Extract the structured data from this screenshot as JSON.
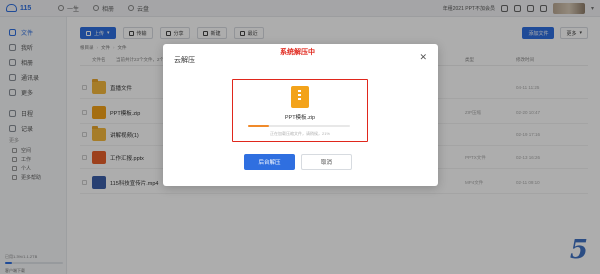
{
  "app": {
    "logo": "115"
  },
  "topnav": [
    "一生",
    "相册",
    "云盘"
  ],
  "topbar": {
    "notice": "年租2021 PPT不加会员"
  },
  "sidebar": {
    "items": [
      {
        "label": "文件",
        "active": true
      },
      {
        "label": "我听"
      },
      {
        "label": "相册"
      },
      {
        "label": "通讯录"
      },
      {
        "label": "更多"
      },
      {
        "label": "日程"
      },
      {
        "label": "记录"
      }
    ],
    "group_label": "更多",
    "subitems": [
      "空间",
      "工作",
      "个人",
      "更多帮助"
    ],
    "storage_text": "已用1.3%/1.1.2TB",
    "storage_fraction": 0.12,
    "storage_link": "客户端下载"
  },
  "toolbar": {
    "upload": "上传",
    "transfer": "传输",
    "share": "分享",
    "new_folder": "新建",
    "recent": "最近",
    "right_primary": "添加文件",
    "more": "更多"
  },
  "breadcrumb": [
    "根目录",
    "文件",
    "文件"
  ],
  "columns": {
    "name": "文件名",
    "info": "当前共计23个文件，2个文件夹",
    "type": "类型",
    "date": "修改时间"
  },
  "files": [
    {
      "name": "直播文件",
      "kind": "folder",
      "type": "",
      "date": "04-11 11:25"
    },
    {
      "name": "PPT模板.zip",
      "kind": "zip",
      "type": "ZIP压缩",
      "date": "02-20 10:47"
    },
    {
      "name": "讲解视频(1)",
      "kind": "folder",
      "type": "",
      "date": "02-19 17:16"
    },
    {
      "name": "工作汇报.pptx",
      "kind": "ppt",
      "type": "PPTX文件",
      "date": "02-13 16:26"
    },
    {
      "name": "115科技宣传片.mp4",
      "kind": "mp4",
      "type": "MP4文件",
      "date": "02-11 09:10"
    }
  ],
  "dialog": {
    "title": "云解压",
    "note": "系统解压中",
    "file_name": "PPT模板.zip",
    "progress_fraction": 0.21,
    "progress_text": "正在加载压缩文件，请稍候，21%",
    "primary": "后台解压",
    "cancel": "取消"
  },
  "corner_number": "5",
  "colors": {
    "accent": "#2f6fe0",
    "highlight": "#e0271c"
  }
}
